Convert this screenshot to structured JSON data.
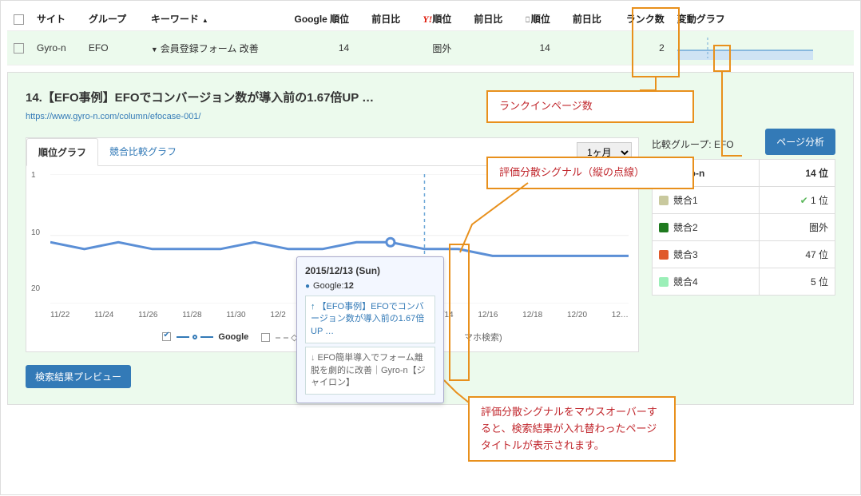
{
  "table": {
    "headers": {
      "site": "サイト",
      "group": "グループ",
      "keyword": "キーワード",
      "google_rank": "Google 順位",
      "google_diff": "前日比",
      "yahoo_rank": "順位",
      "yahoo_diff": "前日比",
      "mobile_rank": "順位",
      "mobile_diff": "前日比",
      "rank_in": "ランク数",
      "spark": "変動グラフ"
    },
    "row": {
      "site": "Gyro-n",
      "group": "EFO",
      "keyword": "会員登録フォーム 改善",
      "google_rank": "14",
      "yahoo_rank": "圏外",
      "mobile_rank": "14",
      "rank_in": "2"
    }
  },
  "annotations": {
    "rank_in_label": "ランクインページ数",
    "signal_label": "評価分散シグナル（縦の点線）",
    "hover_label": "評価分散シグナルをマウスオーバーすると、検索結果が入れ替わったページタイトルが表示されます。"
  },
  "detail": {
    "title": "14.【EFO事例】EFOでコンバージョン数が導入前の1.67倍UP …",
    "url": "https://www.gyro-n.com/column/efocase-001/",
    "analysis_btn": "ページ分析",
    "preview_btn": "検索結果プレビュー"
  },
  "tabs": {
    "rank": "順位グラフ",
    "compare": "競合比較グラフ"
  },
  "period": {
    "value": "1ヶ月"
  },
  "legend": {
    "google": "Google",
    "yahoo": "Y",
    "mobile": "マホ検索)"
  },
  "chart_data": {
    "type": "line",
    "ylabel": "",
    "xlabel": "",
    "y_ticks": [
      1,
      10,
      20
    ],
    "categories": [
      "11/22",
      "11/24",
      "11/26",
      "11/28",
      "11/30",
      "12/2",
      "",
      "",
      "",
      "",
      "",
      "12/14",
      "12/16",
      "12/18",
      "12/20",
      "12…"
    ],
    "series": [
      {
        "name": "Google",
        "values": [
          11,
          12,
          11,
          12,
          12,
          12,
          11,
          12,
          12,
          11,
          11,
          12,
          12,
          13,
          13,
          13,
          13,
          13
        ]
      }
    ],
    "signal_index": 11,
    "highlight_index": 10
  },
  "tooltip": {
    "date": "2015/12/13 (Sun)",
    "source_label": "Google:",
    "source_rank": "12",
    "page_up": "【EFO事例】EFOでコンバージョン数が導入前の1.67倍UP …",
    "page_down": "EFO簡単導入でフォーム離脱を劇的に改善｜Gyro-n【ジャイロン】"
  },
  "compare": {
    "heading": "比較グループ: EFO",
    "rows": [
      {
        "color": "#6ee9a1",
        "name": "Gyro-n",
        "rank": "14 位",
        "bold": true
      },
      {
        "color": "#c9c99e",
        "name": "競合1",
        "rank": "1 位",
        "checked": true
      },
      {
        "color": "#1f7a1f",
        "name": "競合2",
        "rank": "圏外"
      },
      {
        "color": "#e05a2b",
        "name": "競合3",
        "rank": "47 位"
      },
      {
        "color": "#9befb8",
        "name": "競合4",
        "rank": "5 位"
      }
    ]
  }
}
